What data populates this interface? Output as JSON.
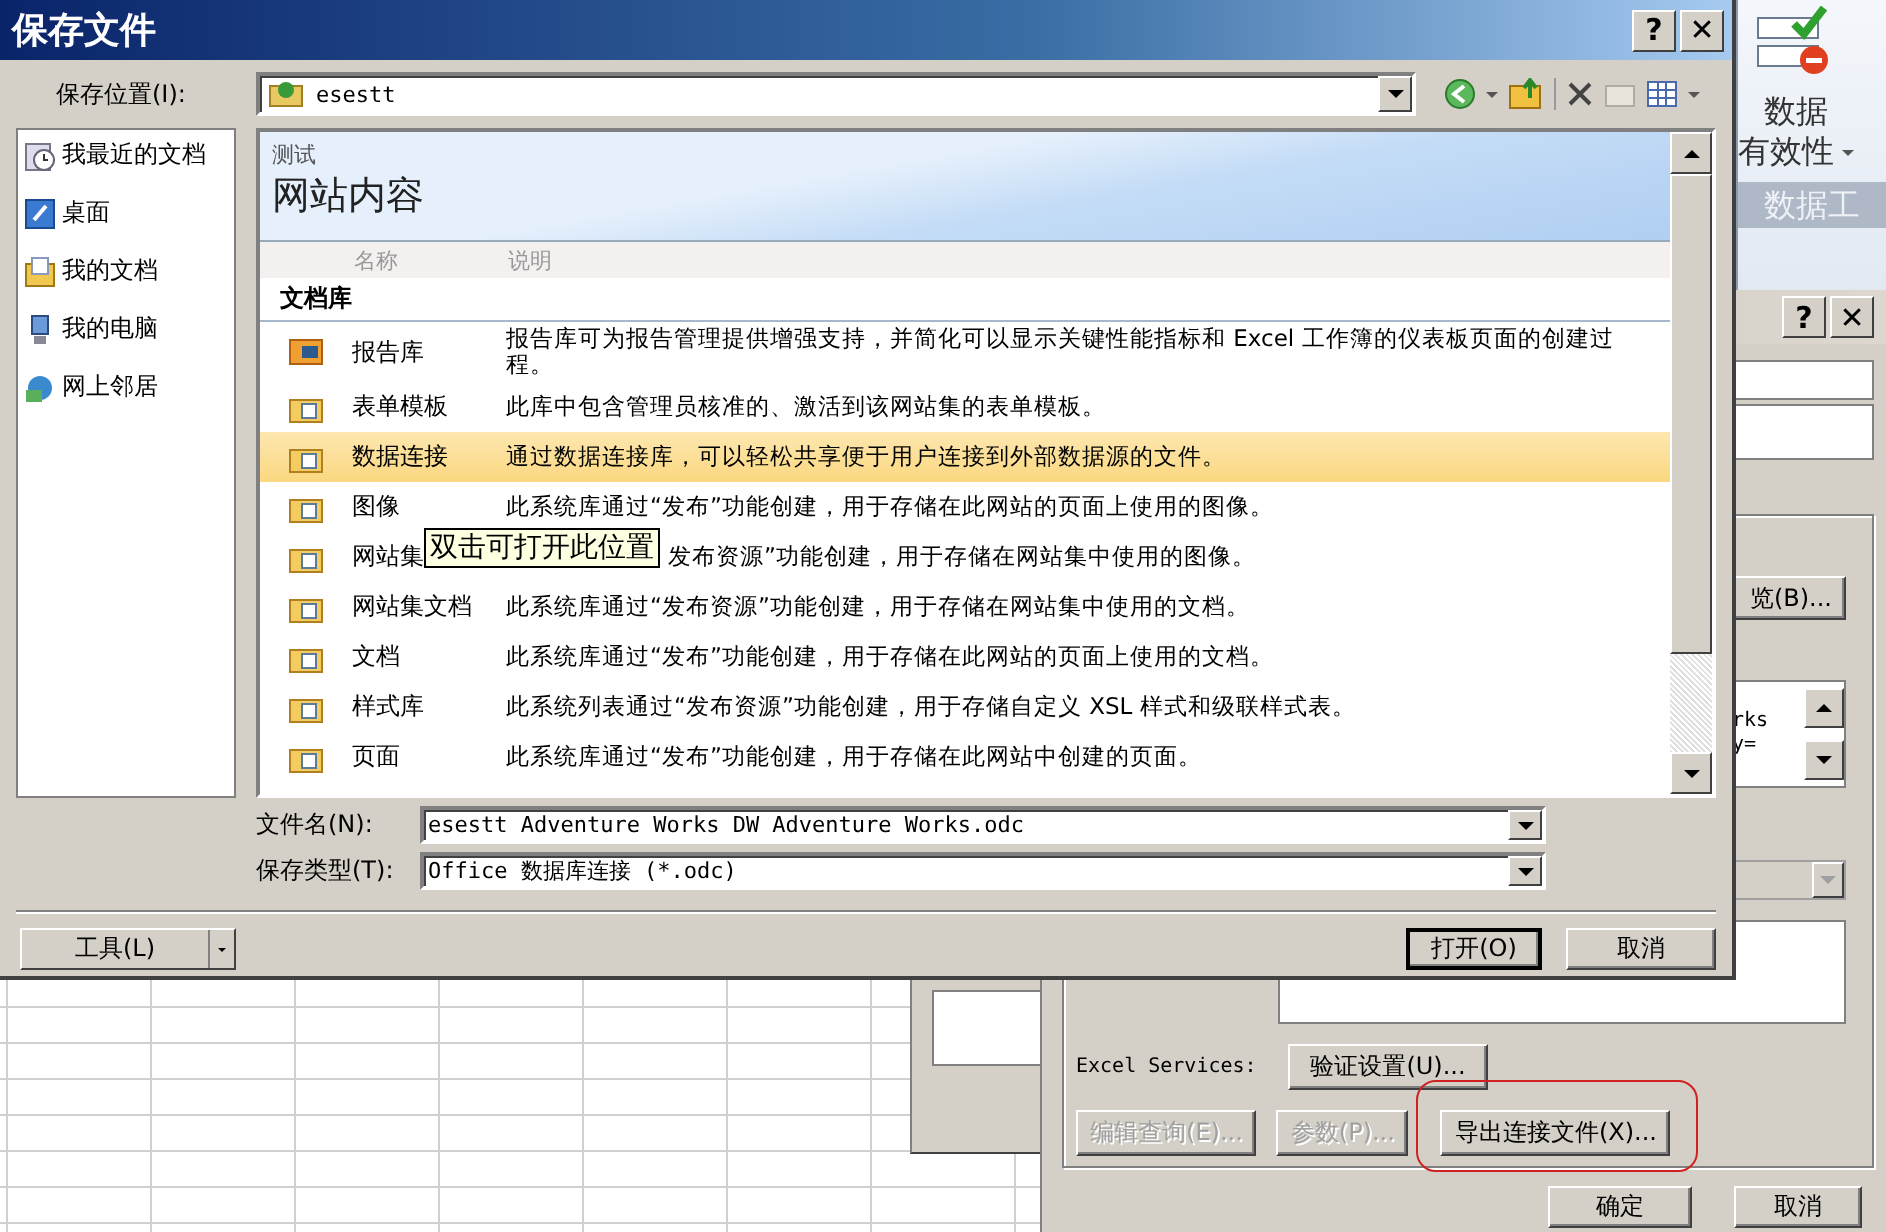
{
  "excel_ribbon": {
    "group_buttons": [
      "数据"
    ],
    "dropdown_label": "有效性",
    "group_title": "数据工"
  },
  "connection_dialog": {
    "help": "?",
    "close": "✕",
    "browse_button": "览(B)...",
    "definition_lines": [
      "rks",
      "y="
    ],
    "services_label": "Excel Services:",
    "buttons": [
      {
        "label": "验证设置(U)...",
        "disabled": false,
        "highlighted": false
      },
      {
        "label": "编辑查询(E)...",
        "disabled": true,
        "highlighted": false
      },
      {
        "label": "参数(P)...",
        "disabled": true,
        "highlighted": false
      },
      {
        "label": "导出连接文件(X)...",
        "disabled": false,
        "highlighted": true
      }
    ],
    "footer_buttons": [
      "确定",
      "取消"
    ]
  },
  "save_dialog": {
    "title": "保存文件",
    "help": "?",
    "close": "✕",
    "location_label": "保存位置(I):",
    "location_value": "esestt",
    "places": [
      {
        "label": "我最近的文档",
        "kind": "recent"
      },
      {
        "label": "桌面",
        "kind": "desktop"
      },
      {
        "label": "我的文档",
        "kind": "documents"
      },
      {
        "label": "我的电脑",
        "kind": "computer"
      },
      {
        "label": "网上邻居",
        "kind": "network"
      }
    ],
    "site": {
      "subtitle": "测试",
      "title": "网站内容"
    },
    "columns": [
      "名称",
      "说明"
    ],
    "group": "文档库",
    "rows": [
      {
        "name": "报告库",
        "description": "报告库可为报告管理提供增强支持，并简化可以显示关键性能指标和 Excel 工作簿的仪表板页面的创建过程。",
        "kind": "report",
        "selected": false
      },
      {
        "name": "表单模板",
        "description": "此库中包含管理员核准的、激活到该网站集的表单模板。",
        "kind": "library",
        "selected": false
      },
      {
        "name": "数据连接",
        "description": "通过数据连接库，可以轻松共享便于用户连接到外部数据源的文件。",
        "kind": "library",
        "selected": true
      },
      {
        "name": "图像",
        "description": "此系统库通过“发布”功能创建，用于存储在此网站的页面上使用的图像。",
        "kind": "library",
        "selected": false
      },
      {
        "name": "网站集",
        "description": "发布资源”功能创建，用于存储在网站集中使用的图像。",
        "kind": "library",
        "selected": false,
        "tooltip": "双击可打开此位置"
      },
      {
        "name": "网站集文档",
        "description": "此系统库通过“发布资源”功能创建，用于存储在网站集中使用的文档。",
        "kind": "library",
        "selected": false
      },
      {
        "name": "文档",
        "description": "此系统库通过“发布”功能创建，用于存储在此网站的页面上使用的文档。",
        "kind": "library",
        "selected": false
      },
      {
        "name": "样式库",
        "description": "此系统列表通过“发布资源”功能创建，用于存储自定义 XSL 样式和级联样式表。",
        "kind": "library",
        "selected": false
      },
      {
        "name": "页面",
        "description": "此系统库通过“发布”功能创建，用于存储在此网站中创建的页面。",
        "kind": "library",
        "selected": false
      }
    ],
    "filename_label": "文件名(N):",
    "filename": "esestt Adventure Works DW Adventure Works.odc",
    "type_label": "保存类型(T):",
    "type": "Office 数据库连接 (*.odc)",
    "tools_button": "工具(L)",
    "open_button": "打开(O)",
    "cancel_button": "取消"
  }
}
